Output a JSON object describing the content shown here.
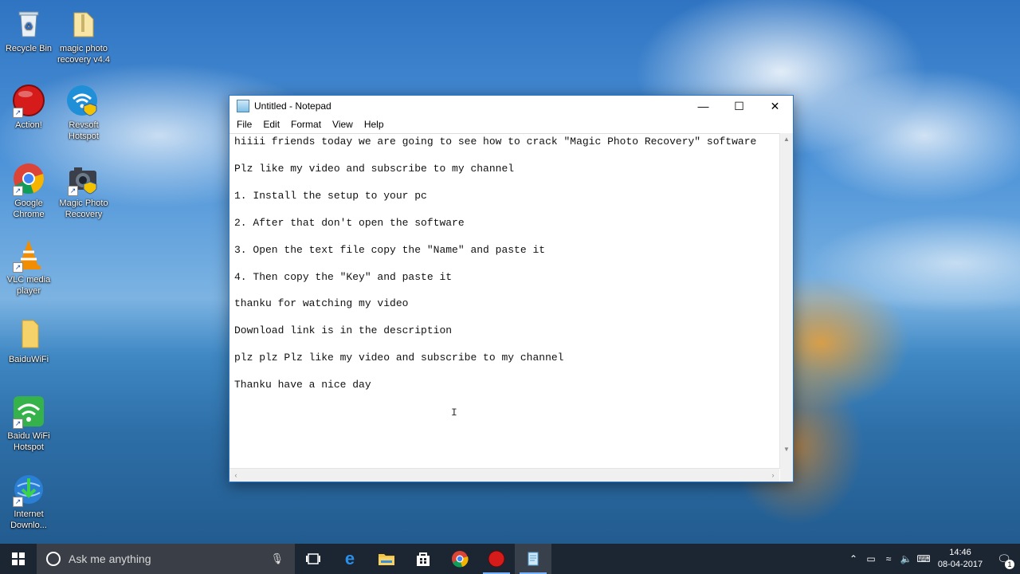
{
  "desktop": {
    "icons": [
      {
        "label": "Recycle Bin"
      },
      {
        "label": "magic photo recovery v4.4"
      },
      {
        "label": "Action!"
      },
      {
        "label": "Revsoft Hotspot"
      },
      {
        "label": "Google Chrome"
      },
      {
        "label": "Magic Photo Recovery"
      },
      {
        "label": "VLC media player"
      },
      {
        "label": "BaiduWiFi"
      },
      {
        "label": "Baidu WiFi Hotspot"
      },
      {
        "label": "Internet Downlo..."
      }
    ]
  },
  "notepad": {
    "title": "Untitled - Notepad",
    "menu": [
      "File",
      "Edit",
      "Format",
      "View",
      "Help"
    ],
    "lines": [
      "hiiii friends today we are going to see how to crack \"Magic Photo Recovery\" software",
      "Plz like my video and subscribe to my channel",
      "1. Install the setup to your pc",
      "2. After that don't open the software",
      "3. Open the text file copy the \"Name\" and paste it",
      "4. Then copy the \"Key\" and paste it",
      "thanku for watching my video",
      "Download link is in the description",
      "plz plz Plz like my video and subscribe to my channel",
      "Thanku have a nice day"
    ]
  },
  "taskbar": {
    "search_placeholder": "Ask me anything",
    "time": "14:46",
    "date": "08-04-2017",
    "notification_count": "1"
  }
}
